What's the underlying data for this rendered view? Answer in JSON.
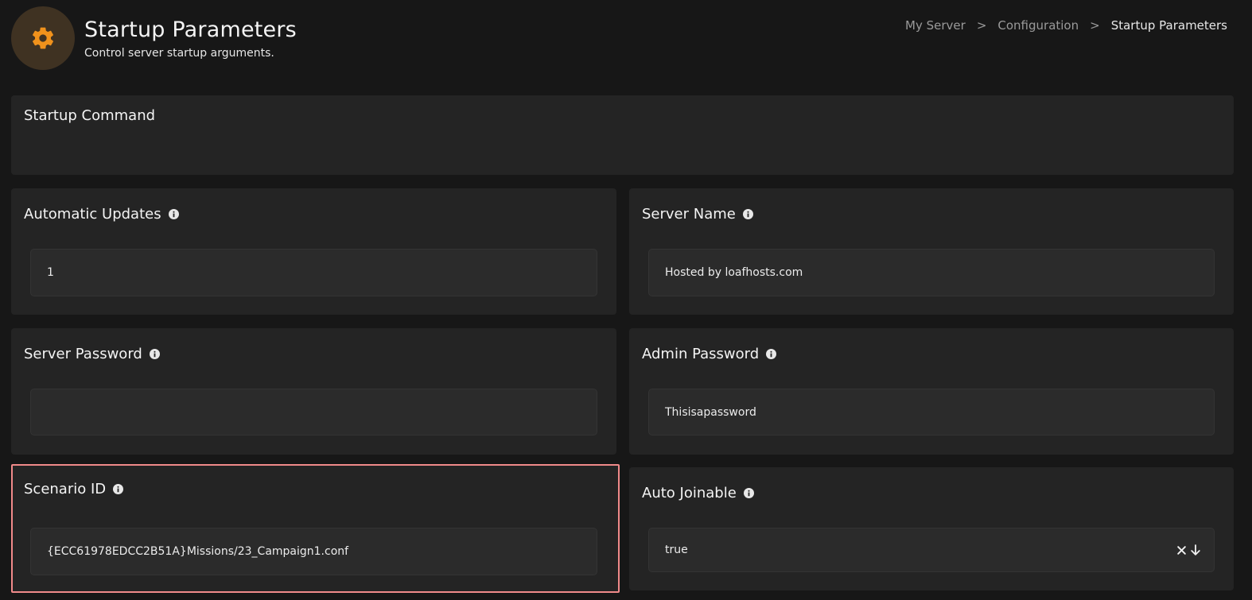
{
  "header": {
    "title": "Startup Parameters",
    "subtitle": "Control server startup arguments.",
    "icon": "gear-icon",
    "accent_color": "#f0921c"
  },
  "breadcrumb": {
    "items": [
      "My Server",
      "Configuration",
      "Startup Parameters"
    ],
    "separator": ">"
  },
  "startup_command": {
    "label": "Startup Command"
  },
  "variables": {
    "automatic_updates": {
      "label": "Automatic Updates",
      "value": "1"
    },
    "server_name": {
      "label": "Server Name",
      "value": "Hosted by loafhosts.com"
    },
    "server_password": {
      "label": "Server Password",
      "value": ""
    },
    "admin_password": {
      "label": "Admin Password",
      "value": "Thisisapassword"
    },
    "scenario_id": {
      "label": "Scenario ID",
      "value": "{ECC61978EDCC2B51A}Missions/23_Campaign1.conf"
    },
    "auto_joinable": {
      "label": "Auto Joinable",
      "value": "true"
    }
  },
  "highlight_color": "#f08a8a"
}
